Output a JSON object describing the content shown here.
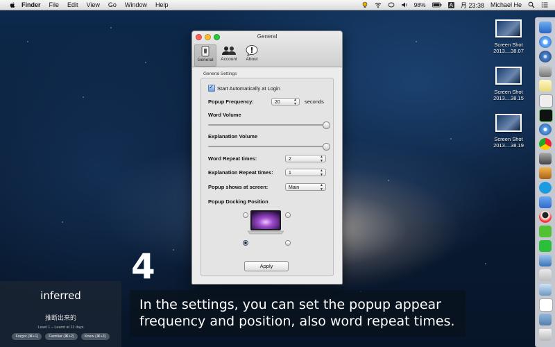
{
  "menubar": {
    "app_name": "Finder",
    "menus": [
      "File",
      "Edit",
      "View",
      "Go",
      "Window",
      "Help"
    ],
    "battery": "98%",
    "input_method": "A",
    "clock": "月 23:38",
    "user": "Michael He"
  },
  "desktop_files": [
    {
      "line1": "Screen Shot",
      "line2": "2013....38.07"
    },
    {
      "line1": "Screen Shot",
      "line2": "2013....38.15"
    },
    {
      "line1": "Screen Shot",
      "line2": "2013....38.19"
    }
  ],
  "window": {
    "title": "General",
    "tabs": [
      {
        "label": "General",
        "icon": "switch-icon",
        "selected": true
      },
      {
        "label": "Account",
        "icon": "people-icon",
        "selected": false
      },
      {
        "label": "About",
        "icon": "info-bubble-icon",
        "selected": false
      }
    ],
    "group_title": "General Settings",
    "start_auto_label": "Start Automatically at Login",
    "start_auto_checked": true,
    "popup_frequency_label": "Popup Frequency:",
    "popup_frequency_value": "20",
    "popup_frequency_unit": "seconds",
    "word_volume_label": "Word Volume",
    "word_volume_value": 1.0,
    "explanation_volume_label": "Explanation Volume",
    "explanation_volume_value": 1.0,
    "word_repeat_label": "Word Repeat times:",
    "word_repeat_value": "2",
    "explanation_repeat_label": "Explanation Repeat times:",
    "explanation_repeat_value": "1",
    "popup_screen_label": "Popup shows at screen:",
    "popup_screen_value": "Main",
    "docking_label": "Popup Docking Position",
    "docking_selected": "bottom-left",
    "apply_label": "Apply"
  },
  "step_number": "4",
  "caption": "In the settings, you can set the popup appear frequency and position, also word repeat times.",
  "card": {
    "word": "inferred",
    "meaning": "推断出来的",
    "meta": "Level 1 – Learnt at 11 days",
    "buttons": [
      "Forgot (⌘+1)",
      "Familiar (⌘+2)",
      "Knew (⌘+3)"
    ]
  },
  "colors": {
    "accent": "#3b6fd6",
    "close": "#ff5f57",
    "minimize": "#febc2e",
    "zoom": "#28c840"
  }
}
